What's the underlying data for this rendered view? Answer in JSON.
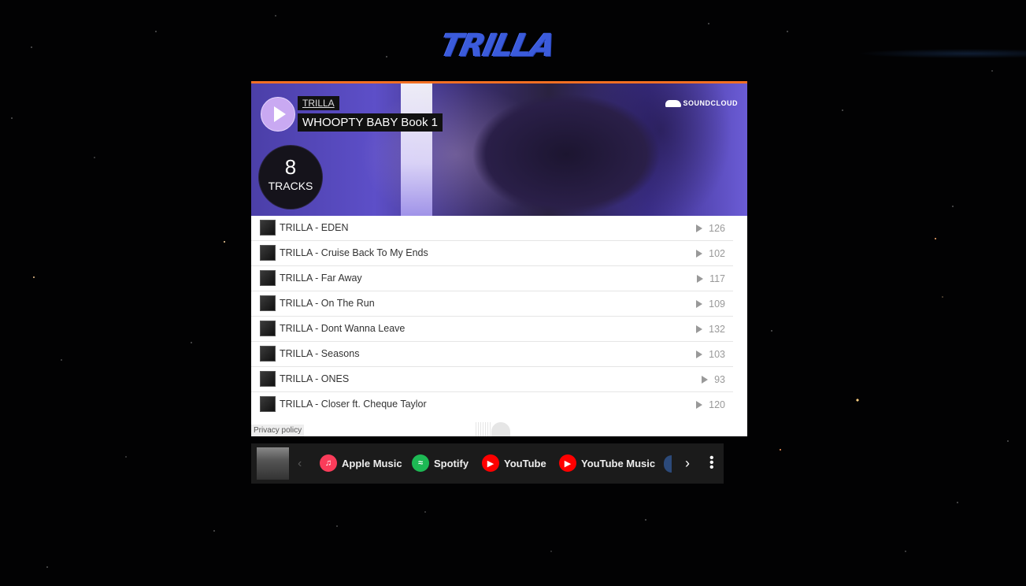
{
  "site": {
    "logo_text": "TRILLA"
  },
  "player": {
    "artist": "TRILLA",
    "title": "WHOOPTY BABY Book 1",
    "provider": "SOUNDCLOUD",
    "track_count": "8",
    "track_count_label": "TRACKS",
    "privacy_label": "Privacy policy",
    "tracks": [
      {
        "name": "TRILLA - EDEN",
        "plays": "126"
      },
      {
        "name": "TRILLA - Cruise Back To My Ends",
        "plays": "102"
      },
      {
        "name": "TRILLA - Far Away",
        "plays": "117"
      },
      {
        "name": "TRILLA - On The Run",
        "plays": "109"
      },
      {
        "name": "TRILLA - Dont Wanna Leave",
        "plays": "132"
      },
      {
        "name": "TRILLA - Seasons",
        "plays": "103"
      },
      {
        "name": "TRILLA - ONES",
        "plays": "93"
      },
      {
        "name": "TRILLA - Closer ft. Cheque Taylor",
        "plays": "120"
      }
    ]
  },
  "streaming_bar": {
    "services": [
      {
        "label": "Apple Music",
        "icon": "apple-music-icon",
        "color": "#fa3c5a"
      },
      {
        "label": "Spotify",
        "icon": "spotify-icon",
        "color": "#1db954"
      },
      {
        "label": "YouTube",
        "icon": "youtube-icon",
        "color": "#ff0000"
      },
      {
        "label": "YouTube Music",
        "icon": "youtube-music-icon",
        "color": "#ff0000"
      }
    ]
  },
  "colors": {
    "accent": "#f26f23",
    "logo": "#3b5bdb"
  }
}
